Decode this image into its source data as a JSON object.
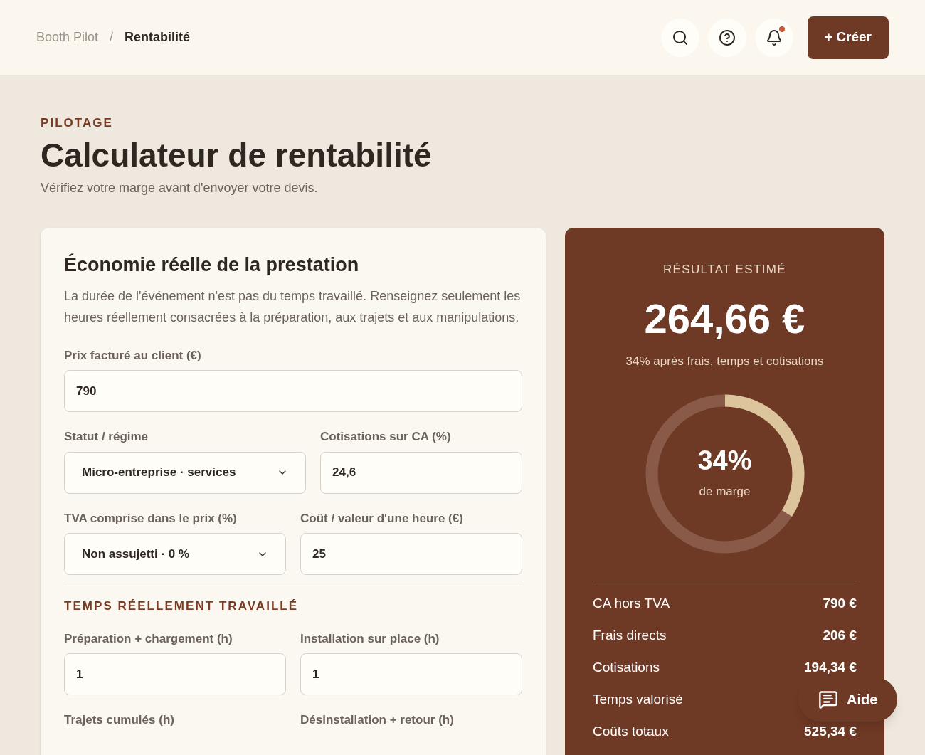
{
  "breadcrumb": [
    {
      "label": "Booth Pilot",
      "current": false
    },
    {
      "label": "Rentabilité",
      "current": true
    }
  ],
  "breadcrumb_separator": "/",
  "header_actions": {
    "notification_dot": true,
    "create_button": "+ Créer"
  },
  "page": {
    "eyebrow": "PILOTAGE",
    "title": "Calculateur de rentabilité",
    "subtitle": "Vérifiez votre marge avant d'envoyer votre devis."
  },
  "form": {
    "title": "Économie réelle de la prestation",
    "description": "La durée de l'événement n'est pas du temps travaillé. Renseignez seulement les heures réellement consacrées à la préparation, aux trajets et aux manipulations.",
    "rows": [
      [
        {
          "kind": "text",
          "label": "Prix facturé au client (€)",
          "value": "790"
        }
      ],
      [
        {
          "kind": "select",
          "label": "Statut / régime",
          "value": "Micro-entreprise · services"
        },
        {
          "kind": "text",
          "label": "Cotisations sur CA (%)",
          "value": "24,6"
        }
      ],
      [
        {
          "kind": "select",
          "label": "TVA comprise dans le prix (%)",
          "value": "Non assujetti · 0 %"
        },
        {
          "kind": "text",
          "label": "Coût / valeur d'une heure (€)",
          "value": "25"
        }
      ]
    ],
    "section_title": "TEMPS RÉELLEMENT TRAVAILLÉ",
    "time_rows": [
      [
        {
          "kind": "text",
          "label": "Préparation + chargement (h)",
          "value": "1"
        },
        {
          "kind": "text",
          "label": "Installation sur place (h)",
          "value": "1"
        }
      ],
      [
        {
          "kind": "label",
          "label": "Trajets cumulés (h)"
        },
        {
          "kind": "label",
          "label": "Désinstallation + retour (h)"
        }
      ]
    ]
  },
  "result": {
    "eyebrow": "RÉSULTAT ESTIMÉ",
    "amount": "264,66 €",
    "caption": "34% après frais, temps et cotisations",
    "gauge": {
      "level": 0.34,
      "value": "34%",
      "label": "de marge"
    },
    "lines": [
      {
        "label": "CA hors TVA",
        "value": "790 €"
      },
      {
        "label": "Frais directs",
        "value": "206 €"
      },
      {
        "label": "Cotisations",
        "value": "194,34 €"
      },
      {
        "label": "Temps valorisé"
      },
      {
        "label": "Coûts totaux",
        "value": "525,34 €"
      }
    ]
  },
  "help_button": "Aide"
}
